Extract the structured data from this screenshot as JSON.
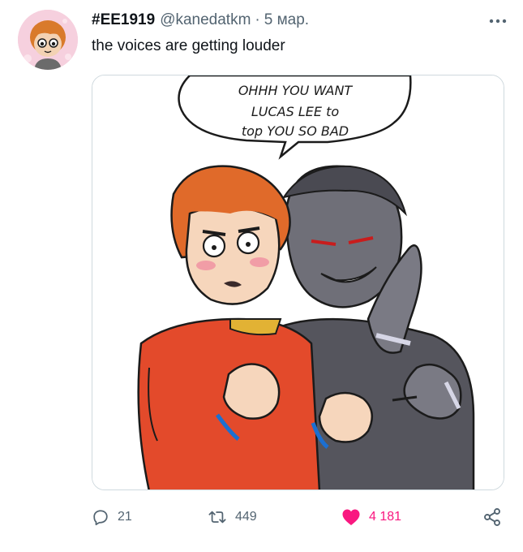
{
  "author": {
    "display_name": "#EE1919",
    "handle": "@kanedatkm",
    "separator": "·",
    "date": "5 мар."
  },
  "tweet": {
    "text": "the voices are getting louder"
  },
  "media": {
    "speech_bubble_lines": [
      "OHHH YOU WANT",
      "LUCAS LEE to",
      "top YOU SO BAD"
    ]
  },
  "actions": {
    "reply_count": "21",
    "retweet_count": "449",
    "like_count": "4 181"
  },
  "colors": {
    "like_active": "#f91880",
    "muted_text": "#536471",
    "primary_text": "#0f1419",
    "border": "#cfd9de"
  },
  "icons": {
    "more": "ellipsis-icon",
    "reply": "reply-icon",
    "retweet": "retweet-icon",
    "like": "heart-icon",
    "share": "share-icon"
  }
}
